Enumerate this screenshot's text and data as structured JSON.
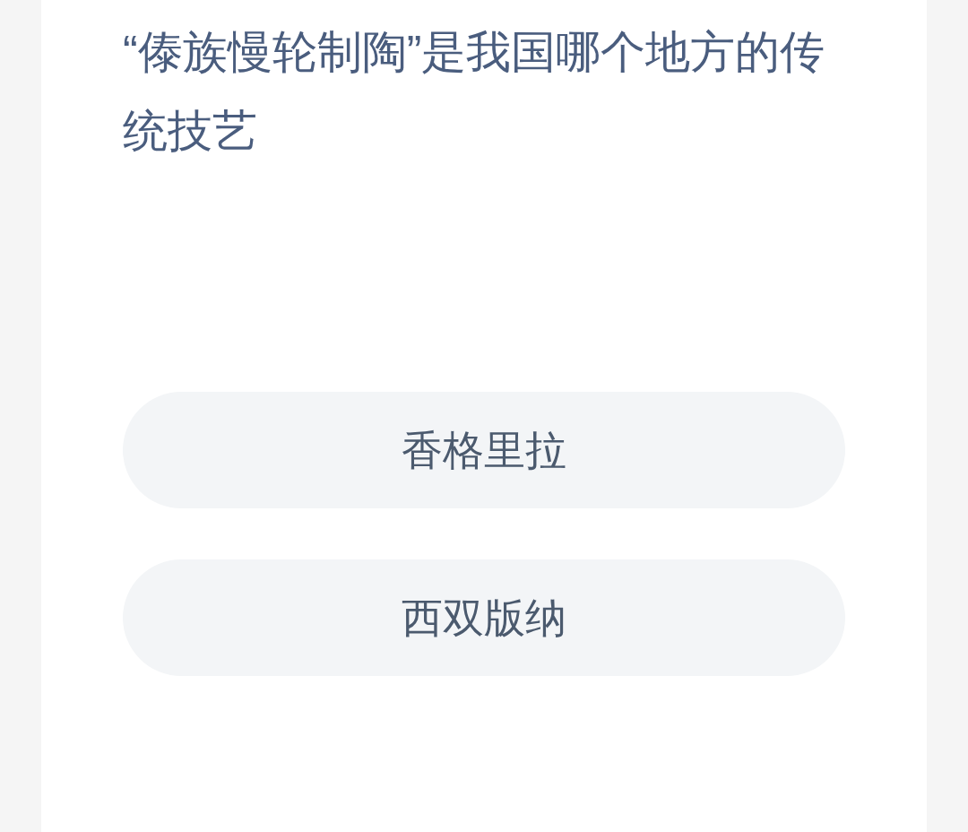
{
  "question": "“傣族慢轮制陶”是我国哪个地方的传统技艺",
  "options": [
    {
      "label": "香格里拉"
    },
    {
      "label": "西双版纳"
    }
  ]
}
